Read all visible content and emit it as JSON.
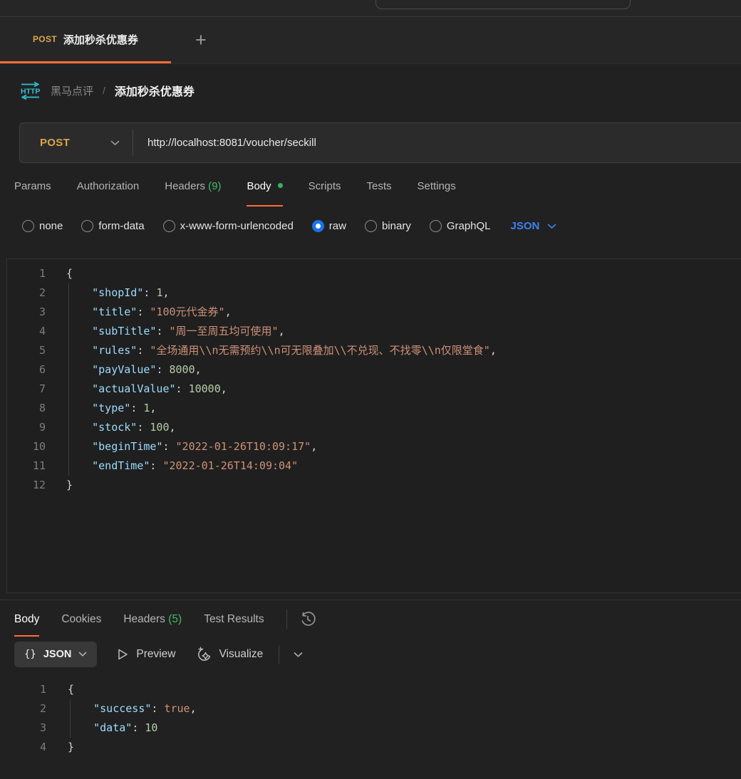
{
  "colors": {
    "accent_orange": "#ff6c37",
    "method_post": "#dca54c",
    "count_green": "#46ba6c",
    "link_blue": "#3b82f0",
    "protocol_cyan": "#2fc4d6",
    "code_key": "#9cdcfe",
    "code_string": "#ce9178",
    "code_number": "#b5cea8"
  },
  "tab_bar": {
    "active_tab": {
      "method": "POST",
      "title": "添加秒杀优惠券"
    },
    "new_tab_label": "+"
  },
  "breadcrumb": {
    "collection": "黑马点评",
    "separator": "/",
    "request_name": "添加秒杀优惠券",
    "protocol": "HTTP"
  },
  "request_bar": {
    "method": "POST",
    "url": "http://localhost:8081/voucher/seckill"
  },
  "request_tabs": {
    "items": [
      {
        "label": "Params"
      },
      {
        "label": "Authorization"
      },
      {
        "label": "Headers",
        "count": " (9)"
      },
      {
        "label": "Body",
        "active": true,
        "dot": true
      },
      {
        "label": "Scripts"
      },
      {
        "label": "Tests"
      },
      {
        "label": "Settings"
      }
    ]
  },
  "body_modes": {
    "options": [
      {
        "label": "none"
      },
      {
        "label": "form-data"
      },
      {
        "label": "x-www-form-urlencoded"
      },
      {
        "label": "raw",
        "selected": true
      },
      {
        "label": "binary"
      },
      {
        "label": "GraphQL"
      }
    ],
    "language": "JSON"
  },
  "request_editor": {
    "lines": [
      {
        "num": "1",
        "guide": false,
        "tokens": [
          {
            "t": "punc",
            "v": "{"
          }
        ]
      },
      {
        "num": "2",
        "guide": true,
        "tokens": [
          {
            "t": "punc",
            "v": "    "
          },
          {
            "t": "key",
            "v": "\"shopId\""
          },
          {
            "t": "punc",
            "v": ": "
          },
          {
            "t": "num",
            "v": "1"
          },
          {
            "t": "punc",
            "v": ","
          }
        ]
      },
      {
        "num": "3",
        "guide": true,
        "tokens": [
          {
            "t": "punc",
            "v": "    "
          },
          {
            "t": "key",
            "v": "\"title\""
          },
          {
            "t": "punc",
            "v": ": "
          },
          {
            "t": "str",
            "v": "\"100元代金券\""
          },
          {
            "t": "punc",
            "v": ","
          }
        ]
      },
      {
        "num": "4",
        "guide": true,
        "tokens": [
          {
            "t": "punc",
            "v": "    "
          },
          {
            "t": "key",
            "v": "\"subTitle\""
          },
          {
            "t": "punc",
            "v": ": "
          },
          {
            "t": "str",
            "v": "\"周一至周五均可使用\""
          },
          {
            "t": "punc",
            "v": ","
          }
        ]
      },
      {
        "num": "5",
        "guide": true,
        "tokens": [
          {
            "t": "punc",
            "v": "    "
          },
          {
            "t": "key",
            "v": "\"rules\""
          },
          {
            "t": "punc",
            "v": ": "
          },
          {
            "t": "str",
            "v": "\"全场通用\\\\n无需预约\\\\n可无限叠加\\\\不兑现、不找零\\\\n仅限堂食\""
          },
          {
            "t": "punc",
            "v": ","
          }
        ]
      },
      {
        "num": "6",
        "guide": true,
        "tokens": [
          {
            "t": "punc",
            "v": "    "
          },
          {
            "t": "key",
            "v": "\"payValue\""
          },
          {
            "t": "punc",
            "v": ": "
          },
          {
            "t": "num",
            "v": "8000"
          },
          {
            "t": "punc",
            "v": ","
          }
        ]
      },
      {
        "num": "7",
        "guide": true,
        "tokens": [
          {
            "t": "punc",
            "v": "    "
          },
          {
            "t": "key",
            "v": "\"actualValue\""
          },
          {
            "t": "punc",
            "v": ": "
          },
          {
            "t": "num",
            "v": "10000"
          },
          {
            "t": "punc",
            "v": ","
          }
        ]
      },
      {
        "num": "8",
        "guide": true,
        "tokens": [
          {
            "t": "punc",
            "v": "    "
          },
          {
            "t": "key",
            "v": "\"type\""
          },
          {
            "t": "punc",
            "v": ": "
          },
          {
            "t": "num",
            "v": "1"
          },
          {
            "t": "punc",
            "v": ","
          }
        ]
      },
      {
        "num": "9",
        "guide": true,
        "tokens": [
          {
            "t": "punc",
            "v": "    "
          },
          {
            "t": "key",
            "v": "\"stock\""
          },
          {
            "t": "punc",
            "v": ": "
          },
          {
            "t": "num",
            "v": "100"
          },
          {
            "t": "punc",
            "v": ","
          }
        ]
      },
      {
        "num": "10",
        "guide": true,
        "tokens": [
          {
            "t": "punc",
            "v": "    "
          },
          {
            "t": "key",
            "v": "\"beginTime\""
          },
          {
            "t": "punc",
            "v": ": "
          },
          {
            "t": "str",
            "v": "\"2022-01-26T10:09:17\""
          },
          {
            "t": "punc",
            "v": ","
          }
        ]
      },
      {
        "num": "11",
        "guide": true,
        "tokens": [
          {
            "t": "punc",
            "v": "    "
          },
          {
            "t": "key",
            "v": "\"endTime\""
          },
          {
            "t": "punc",
            "v": ": "
          },
          {
            "t": "str",
            "v": "\"2022-01-26T14:09:04\""
          }
        ]
      },
      {
        "num": "12",
        "guide": false,
        "tokens": [
          {
            "t": "punc",
            "v": "}"
          }
        ]
      }
    ]
  },
  "response_tabs": {
    "items": [
      {
        "label": "Body",
        "active": true
      },
      {
        "label": "Cookies"
      },
      {
        "label": "Headers",
        "count": " (5)"
      },
      {
        "label": "Test Results"
      }
    ]
  },
  "response_toolbar": {
    "format_icon": "{}",
    "format_label": "JSON",
    "preview_label": "Preview",
    "visualize_label": "Visualize"
  },
  "response_editor": {
    "lines": [
      {
        "num": "1",
        "guide": false,
        "tokens": [
          {
            "t": "punc",
            "v": "{"
          }
        ]
      },
      {
        "num": "2",
        "guide": true,
        "tokens": [
          {
            "t": "punc",
            "v": "    "
          },
          {
            "t": "key",
            "v": "\"success\""
          },
          {
            "t": "punc",
            "v": ": "
          },
          {
            "t": "bool",
            "v": "true"
          },
          {
            "t": "punc",
            "v": ","
          }
        ]
      },
      {
        "num": "3",
        "guide": true,
        "tokens": [
          {
            "t": "punc",
            "v": "    "
          },
          {
            "t": "key",
            "v": "\"data\""
          },
          {
            "t": "punc",
            "v": ": "
          },
          {
            "t": "num",
            "v": "10"
          }
        ]
      },
      {
        "num": "4",
        "guide": false,
        "tokens": [
          {
            "t": "punc",
            "v": "}"
          }
        ]
      }
    ]
  }
}
